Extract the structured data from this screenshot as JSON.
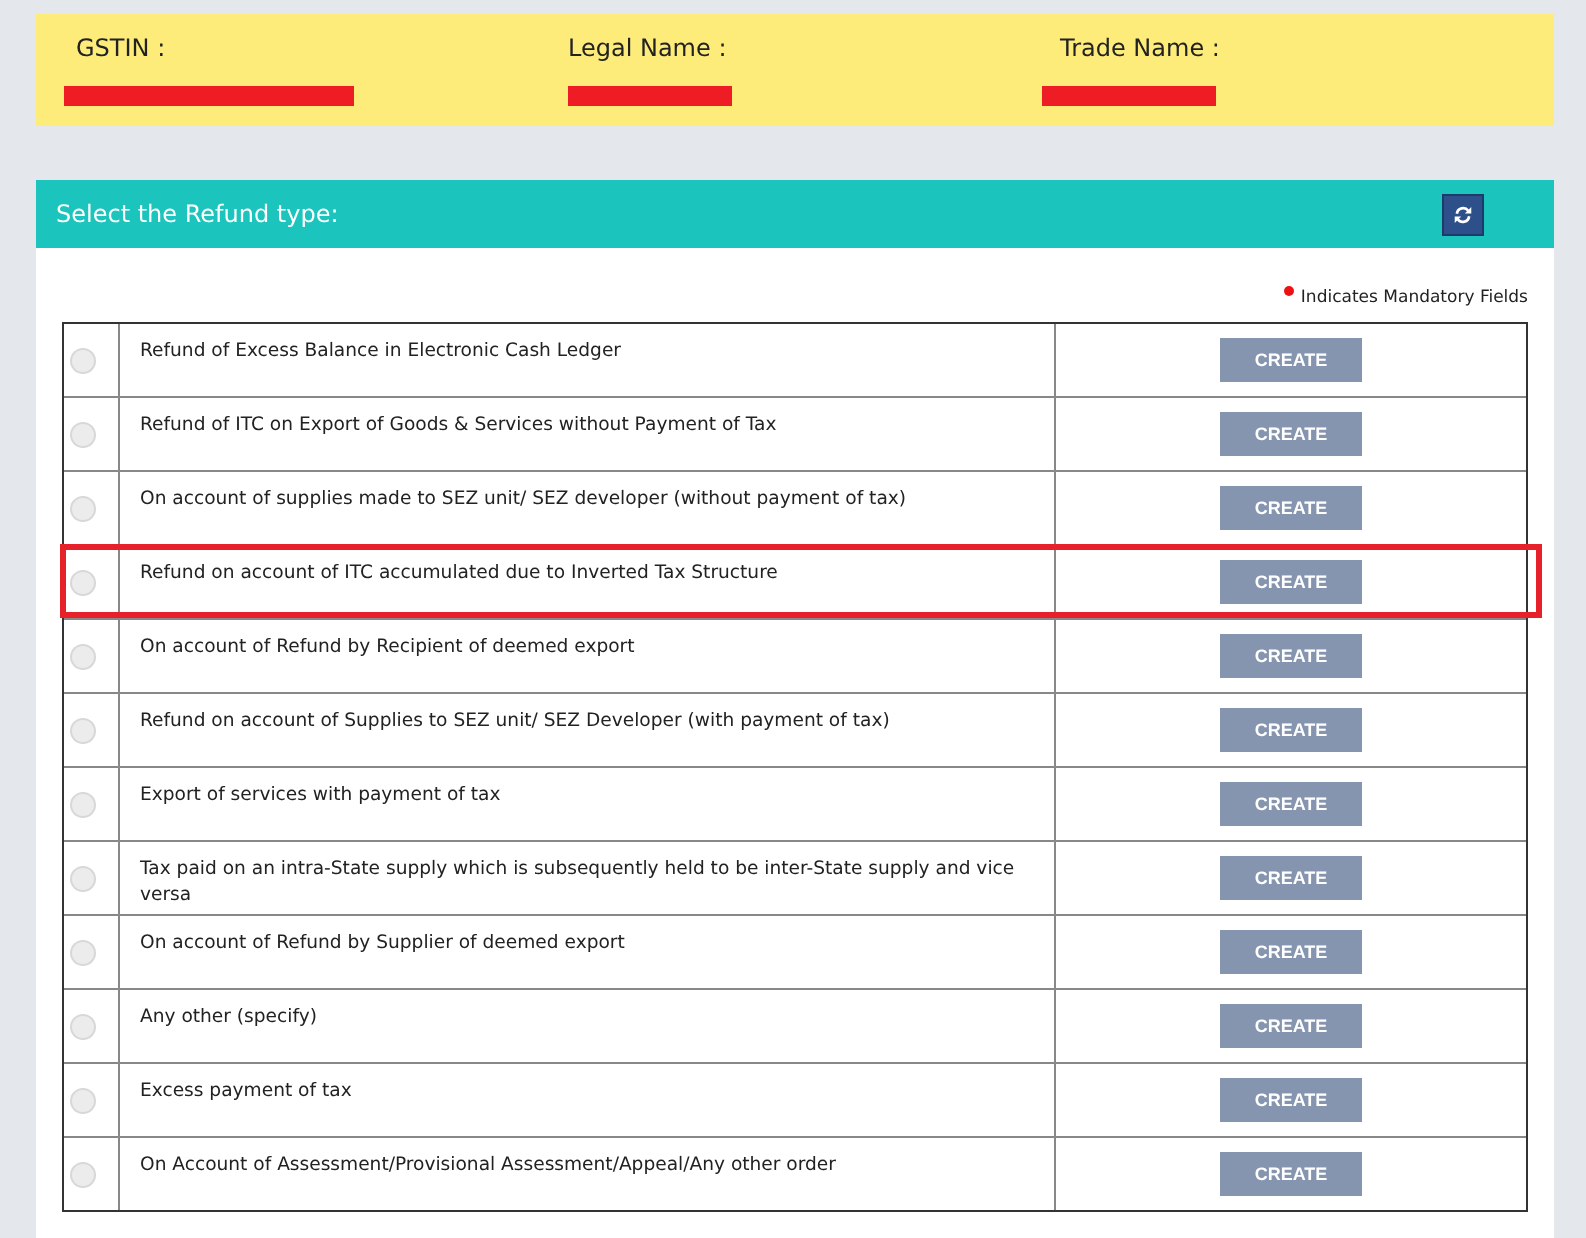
{
  "taxpayer_info": [
    {
      "label": "GSTIN :",
      "redacted": true
    },
    {
      "label": "Legal Name :",
      "redacted": true
    },
    {
      "label": "Trade Name :",
      "redacted": true
    }
  ],
  "section": {
    "title": "Select the Refund type:"
  },
  "mandatory_note": "Indicates Mandatory Fields",
  "rows": [
    {
      "label": "Refund of Excess Balance in Electronic Cash Ledger",
      "selected": false,
      "highlighted": false,
      "button": {
        "label": "CREATE",
        "disabled": true
      }
    },
    {
      "label": "Refund of ITC on Export of Goods & Services without Payment of Tax",
      "selected": false,
      "highlighted": false,
      "button": {
        "label": "CREATE",
        "disabled": true
      }
    },
    {
      "label": "On account of supplies made to SEZ unit/ SEZ developer (without payment of tax)",
      "selected": false,
      "highlighted": false,
      "button": {
        "label": "CREATE",
        "disabled": true
      }
    },
    {
      "label": "Refund on account of ITC accumulated due to Inverted Tax Structure",
      "selected": false,
      "highlighted": true,
      "button": {
        "label": "CREATE",
        "disabled": true
      }
    },
    {
      "label": "On account of Refund by Recipient of deemed export",
      "selected": false,
      "highlighted": false,
      "button": {
        "label": "CREATE",
        "disabled": true
      }
    },
    {
      "label": "Refund on account of Supplies to SEZ unit/ SEZ Developer (with payment of tax)",
      "selected": false,
      "highlighted": false,
      "button": {
        "label": "CREATE",
        "disabled": true
      }
    },
    {
      "label": "Export of services with payment of tax",
      "selected": false,
      "highlighted": false,
      "button": {
        "label": "CREATE",
        "disabled": true
      }
    },
    {
      "label": "Tax paid on an intra-State supply which is subsequently held to be inter-State supply and vice versa",
      "selected": false,
      "highlighted": false,
      "button": {
        "label": "CREATE",
        "disabled": true
      }
    },
    {
      "label": "On account of Refund by Supplier of deemed export",
      "selected": false,
      "highlighted": false,
      "button": {
        "label": "CREATE",
        "disabled": true
      }
    },
    {
      "label": "Any other (specify)",
      "selected": false,
      "highlighted": false,
      "button": {
        "label": "CREATE",
        "disabled": true
      }
    },
    {
      "label": "Excess payment of tax",
      "selected": false,
      "highlighted": false,
      "button": {
        "label": "CREATE",
        "disabled": true
      }
    },
    {
      "label": "On Account of Assessment/Provisional Assessment/Appeal/Any other order",
      "selected": false,
      "highlighted": false,
      "button": {
        "label": "CREATE",
        "disabled": true
      }
    }
  ]
}
